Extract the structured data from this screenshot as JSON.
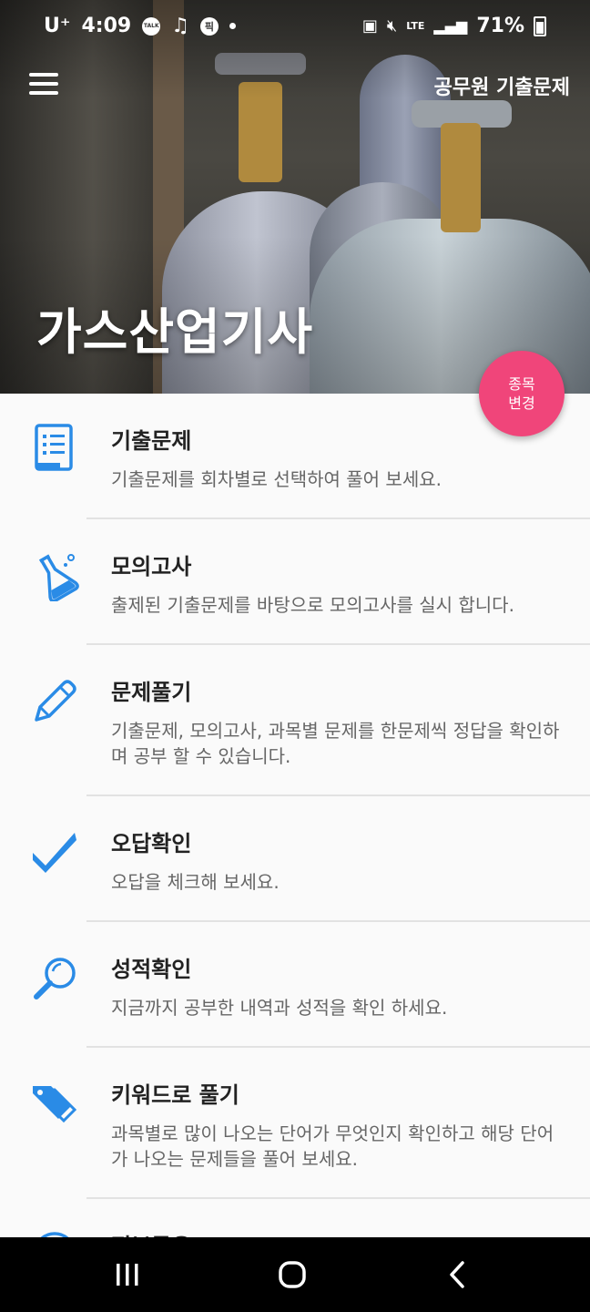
{
  "statusbar": {
    "carrier": "U⁺",
    "time": "4:09",
    "talk_badge": "TALK",
    "pick_badge": "픽",
    "network": "LTE",
    "battery": "71%"
  },
  "header": {
    "app_title": "공무원 기출문제",
    "subject_title": "가스산업기사"
  },
  "fab": {
    "line1": "종목",
    "line2": "변경"
  },
  "menu": {
    "items": [
      {
        "title": "기출문제",
        "desc": "기출문제를 회차별로 선택하여 풀어 보세요.",
        "icon": "document-list-icon"
      },
      {
        "title": "모의고사",
        "desc": "출제된 기출문제를 바탕으로 모의고사를 실시 합니다.",
        "icon": "flask-icon"
      },
      {
        "title": "문제풀기",
        "desc": "기출문제, 모의고사, 과목별 문제를 한문제씩 정답을 확인하며 공부 할 수 있습니다.",
        "icon": "pencil-icon"
      },
      {
        "title": "오답확인",
        "desc": "오답을 체크해 보세요.",
        "icon": "checkmark-icon"
      },
      {
        "title": "성적확인",
        "desc": "지금까지 공부한 내역과 성적을 확인 하세요.",
        "icon": "magnifier-icon"
      },
      {
        "title": "키워드로 풀기",
        "desc": "과목별로 많이 나오는 단어가 무엇인지 확인하고 해당 단어가 나오는 문제들을 풀어 보세요.",
        "icon": "tags-icon"
      },
      {
        "title": "정보공유",
        "desc": "",
        "icon": "share-icon"
      }
    ]
  },
  "colors": {
    "accent": "#2a8be6",
    "fab": "#f0457a"
  }
}
